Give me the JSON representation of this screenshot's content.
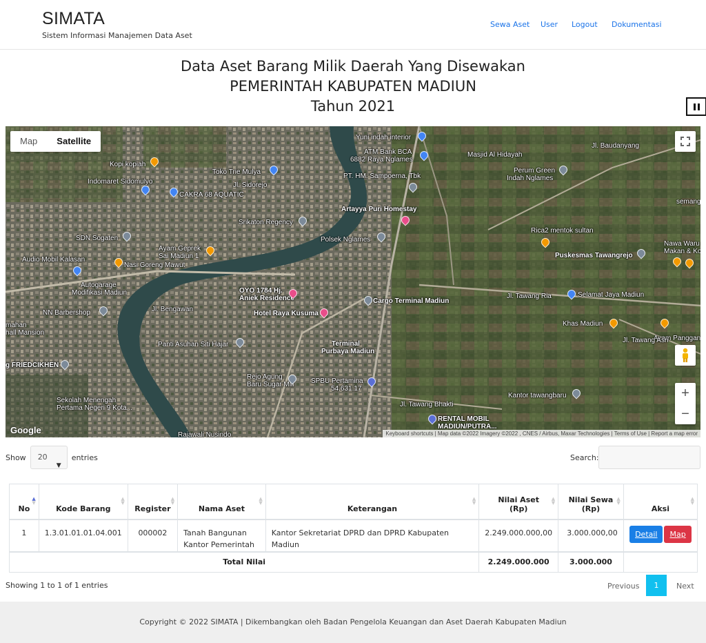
{
  "brand": {
    "name": "SIMATA",
    "subtitle": "Sistem Informasi Manajemen Data Aset"
  },
  "nav": {
    "sewa_aset": "Sewa Aset",
    "user": "User",
    "logout": "Logout",
    "dokumentasi": "Dokumentasi"
  },
  "title": {
    "line1": "Data Aset Barang Milik Daerah Yang Disewakan",
    "line2": "PEMERINTAH KABUPATEN MADIUN",
    "line3": "Tahun 2021"
  },
  "map": {
    "type_map": "Map",
    "type_satellite": "Satellite",
    "zoom_in": "+",
    "zoom_out": "−",
    "google": "Google",
    "attribution": "Keyboard shortcuts  |  Map data ©2022 Imagery ©2022 , CNES / Airbus, Maxar Technologies  |  Terms of Use  |  Report a map error",
    "labels": {
      "l1": "Yuni indah interior",
      "l2": "ATM Bank BCA",
      "l3": "6882 Raya Nglames",
      "l4": "Masjid Al Hidayah",
      "l5": "Jl. Baudanyang",
      "l6": "Kopi kopiah",
      "l7": "Toko Trie Mulya",
      "l8": "Perum Green",
      "l9": "Indah Nglames",
      "l10": "Indomaret Sidomulyo",
      "l11": "Jl. Sidorejo",
      "l12": "PT. HM. Sampoerna, Tbk",
      "l13": "CAKRA 68 AQUATIC",
      "l14": "Artayya Puri Homestay",
      "l15": "Srikaton Regency",
      "l16": "Rica2 mentok sultan",
      "l17": "SDN Sogaten",
      "l18": "Polsek Nglames",
      "l19": "Ayam Geprek",
      "l20": "Sai Madiun 1",
      "l21": "Nawa Waru",
      "l22": "Makan & Ko",
      "l23": "Audio Mobil Kalasan",
      "l24": "Nasi Goreng Mawut",
      "l25": "Puskesmas Tawangrejo",
      "l26": "Autogarage",
      "l27": "Modifikasi Madiun",
      "l28": "OYO 1784 Hj.",
      "l29": "Aniek Residence",
      "l30": "Cargo Terminal Madiun",
      "l31": "Selamat Jaya Madiun",
      "l32": "NN Barbershop",
      "l33": "Hotel Raya Kusuma",
      "l34": "Khas Madiun",
      "l35": "mahan",
      "l36": "hall Mansion",
      "l37": "Panti Asuhan Siti Hajar",
      "l38": "Terminal",
      "l39": "Purbaya Madiun",
      "l40": "Ayam Panggang",
      "l41": "g FRIEDCIKHEN",
      "l42": "Rejo Agung",
      "l43": "Baru Sugar Mill",
      "l44": "SPBU Pertamina",
      "l45": "54.631.17",
      "l46": "Kantor tawangbaru",
      "l47": "Sekolah Menengah",
      "l48": "Pertama Negeri 9 Kota...",
      "l49": "RENTAL MOBIL",
      "l50": "MADIUN/PUTRA...",
      "l51": "Rajawali Nusindo",
      "l52": "Jl. Tawang Ria",
      "l53": "Jl. Bengawan",
      "l54": "Jl. Tawang Bhakti",
      "l55": "Jl. Tawang Asri",
      "l56": "semang"
    }
  },
  "table_controls": {
    "show_label": "Show",
    "page_size": "20",
    "entries_label": "entries",
    "search_label": "Search:",
    "search_value": ""
  },
  "table": {
    "headers": {
      "no": "No",
      "kode": "Kode Barang",
      "register": "Register",
      "nama": "Nama Aset",
      "keterangan": "Keterangan",
      "nilai_aset_1": "Nilai Aset",
      "nilai_aset_2": "(Rp)",
      "nilai_sewa_1": "Nilai Sewa",
      "nilai_sewa_2": "(Rp)",
      "aksi": "Aksi"
    },
    "rows": [
      {
        "no": "1",
        "kode": "1.3.01.01.01.04.001",
        "register": "000002",
        "nama": "Tanah Bangunan Kantor Pemerintah",
        "keterangan": "Kantor Sekretariat DPRD dan DPRD Kabupaten Madiun",
        "nilai_aset": "2.249.000.000,00",
        "nilai_sewa": "3.000.000,00",
        "detail_label": "Detail",
        "map_label": "Map"
      }
    ],
    "footer": {
      "label": "Total Nilai",
      "total_aset": "2.249.000.000",
      "total_sewa": "3.000.000"
    }
  },
  "pagination": {
    "info": "Showing 1 to 1 of 1 entries",
    "previous": "Previous",
    "current": "1",
    "next": "Next"
  },
  "footer": {
    "text": "Copyright © 2022 SIMATA | Dikembangkan oleh Badan Pengelola Keuangan dan Aset Daerah Kabupaten Madiun"
  },
  "colors": {
    "link": "#1a73e8",
    "detail_button": "#1a7fe6",
    "map_button": "#dc3545",
    "page_active": "#11c0ef",
    "footer_bg": "#efefef"
  }
}
